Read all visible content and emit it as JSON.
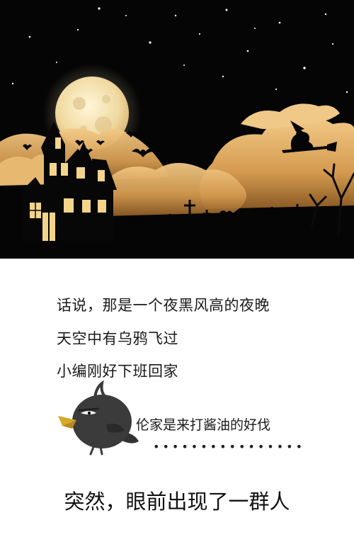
{
  "story": {
    "line1": "话说，那是一个夜黑风高的夜晚",
    "line2": "天空中有乌鸦飞过",
    "line3": "小编刚好下班回家",
    "speech": "伦家是来打酱油的好伐",
    "dots": "••••••••••••••••",
    "bottom": "突然，眼前出现了一群人"
  },
  "icons": {
    "moon": "moon-icon",
    "house": "haunted-house-icon",
    "witch": "witch-icon",
    "bats": "bat-icon",
    "crow": "crow-icon"
  },
  "colors": {
    "sky": "#050505",
    "moon": "#f2e0b0",
    "cloud": "#d9a35a",
    "window": "#f3d48a",
    "text": "#1a1a1a"
  }
}
